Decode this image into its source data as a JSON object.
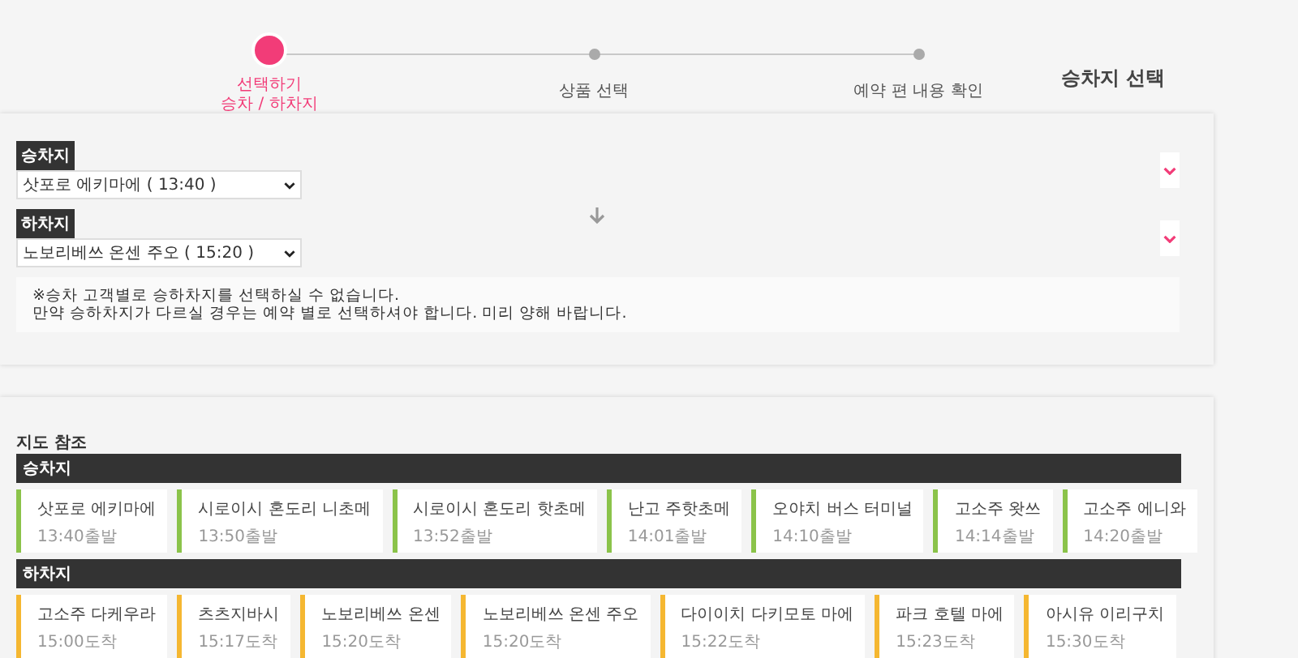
{
  "steps": [
    {
      "label": "선택하기",
      "sublabel": "승차 / 하차지",
      "selected": true
    },
    {
      "label": "상품 선택",
      "selected": false
    },
    {
      "label": "예약 편 내용 확인",
      "selected": false
    }
  ],
  "page_title": "승차지 선택",
  "selection": {
    "fields": [
      {
        "label": "승차지",
        "value": "삿포로 에키마에 ( 13:40 )"
      },
      {
        "label": "하차지",
        "value": "노보리베쓰 온센 주오 ( 15:20 )"
      }
    ],
    "notes": [
      "※승차 고객별로 승하차지를 선택하실 수 없습니다.",
      "만약 승하차지가 다르실 경우는 예약 별로 선택하셔야 합니다. 미리 양해 바랍니다."
    ]
  },
  "map_reference": {
    "title": "지도 참조",
    "sections": [
      {
        "title": "승차지",
        "color": "#8bc34a",
        "stops": [
          {
            "name": "삿포로 에키마에",
            "time": "13:40출발"
          },
          {
            "name": "시로이시 혼도리 니초메",
            "time": "13:50출발"
          },
          {
            "name": "시로이시 혼도리 핫초메",
            "time": "13:52출발"
          },
          {
            "name": "난고 주핫초메",
            "time": "14:01출발"
          },
          {
            "name": "오야치 버스 터미널",
            "time": "14:10출발"
          },
          {
            "name": "고소주 왓쓰",
            "time": "14:14출발"
          },
          {
            "name": "고소주 에니와",
            "time": "14:20출발"
          }
        ]
      },
      {
        "title": "하차지",
        "color": "#f5b731",
        "stops": [
          {
            "name": "고소주 다케우라",
            "time": "15:00도착"
          },
          {
            "name": "츠츠지바시",
            "time": "15:17도착"
          },
          {
            "name": "노보리베쓰 온센",
            "time": "15:20도착"
          },
          {
            "name": "노보리베쓰 온센 주오",
            "time": "15:20도착"
          },
          {
            "name": "다이이치 다키모토 마에",
            "time": "15:22도착"
          },
          {
            "name": "파크 호텔 마에",
            "time": "15:23도착"
          },
          {
            "name": "아시유 이리구치",
            "time": "15:30도착"
          }
        ]
      }
    ]
  }
}
